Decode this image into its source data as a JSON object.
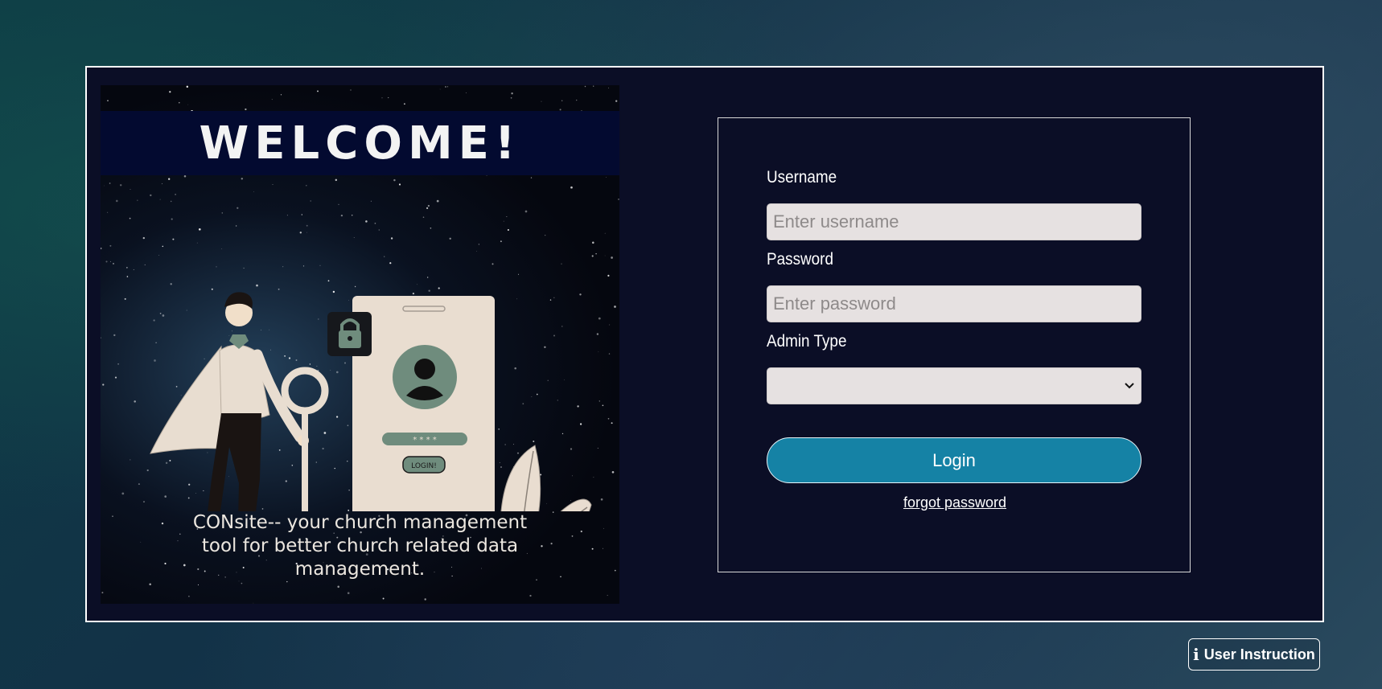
{
  "welcome_panel": {
    "title": "WELCOME!",
    "caption_lines": [
      "CONsite-- your church management",
      "tool for better church related data",
      "management."
    ],
    "phone_mock": {
      "password_mask": "* * * *",
      "login_label": "LOGIN!"
    }
  },
  "login_form": {
    "username": {
      "label": "Username",
      "placeholder": "Enter username",
      "value": ""
    },
    "password": {
      "label": "Password",
      "placeholder": "Enter password",
      "value": ""
    },
    "admin_type": {
      "label": "Admin Type",
      "selected": ""
    },
    "login_label": "Login",
    "forgot_label": "forgot password"
  },
  "footer": {
    "user_instruction_label": "User Instruction"
  },
  "icons": {
    "lock": "lock-icon",
    "avatar": "avatar-icon",
    "info": "info-icon",
    "chevron": "chevron-down-icon",
    "key": "key-icon",
    "leaf": "leaf-icon"
  },
  "colors": {
    "panel_bg": "#0b0e26",
    "banner_bg": "#030a30",
    "button_bg": "#1582a5",
    "input_bg": "#e6e1e1",
    "phone_body": "#e9ddd0",
    "phone_accent": "#6f8c7d"
  }
}
